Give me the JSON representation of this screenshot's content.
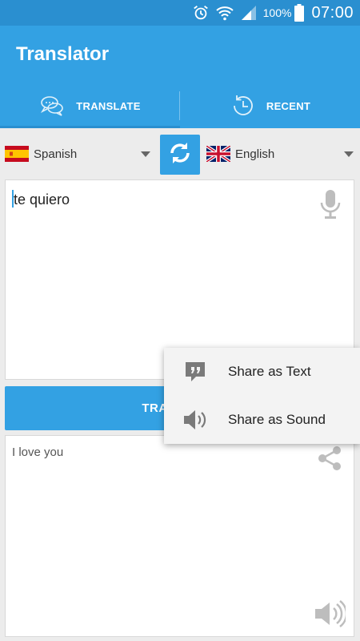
{
  "status_bar": {
    "battery_percent": "100%",
    "time": "07:00",
    "icons": [
      "alarm-icon",
      "wifi-icon",
      "signal-icon",
      "battery-icon"
    ]
  },
  "app": {
    "title": "Translator",
    "accent_color": "#33a1e3",
    "status_bar_color": "#2a8fd0"
  },
  "tabs": [
    {
      "label": "TRANSLATE",
      "icon": "chat-bubbles-icon",
      "selected": true
    },
    {
      "label": "RECENT",
      "icon": "history-icon",
      "selected": false
    }
  ],
  "languages": {
    "source": {
      "name": "Spanish",
      "flag": "spain-flag-icon"
    },
    "target": {
      "name": "English",
      "flag": "uk-flag-icon"
    }
  },
  "input": {
    "value": "te quiero"
  },
  "translate_button": {
    "label": "TRANSLATE"
  },
  "output": {
    "value": "I love you"
  },
  "share_menu": {
    "items": [
      {
        "label": "Share as Text",
        "icon": "quote-bubble-icon"
      },
      {
        "label": "Share as Sound",
        "icon": "speaker-icon"
      }
    ]
  }
}
